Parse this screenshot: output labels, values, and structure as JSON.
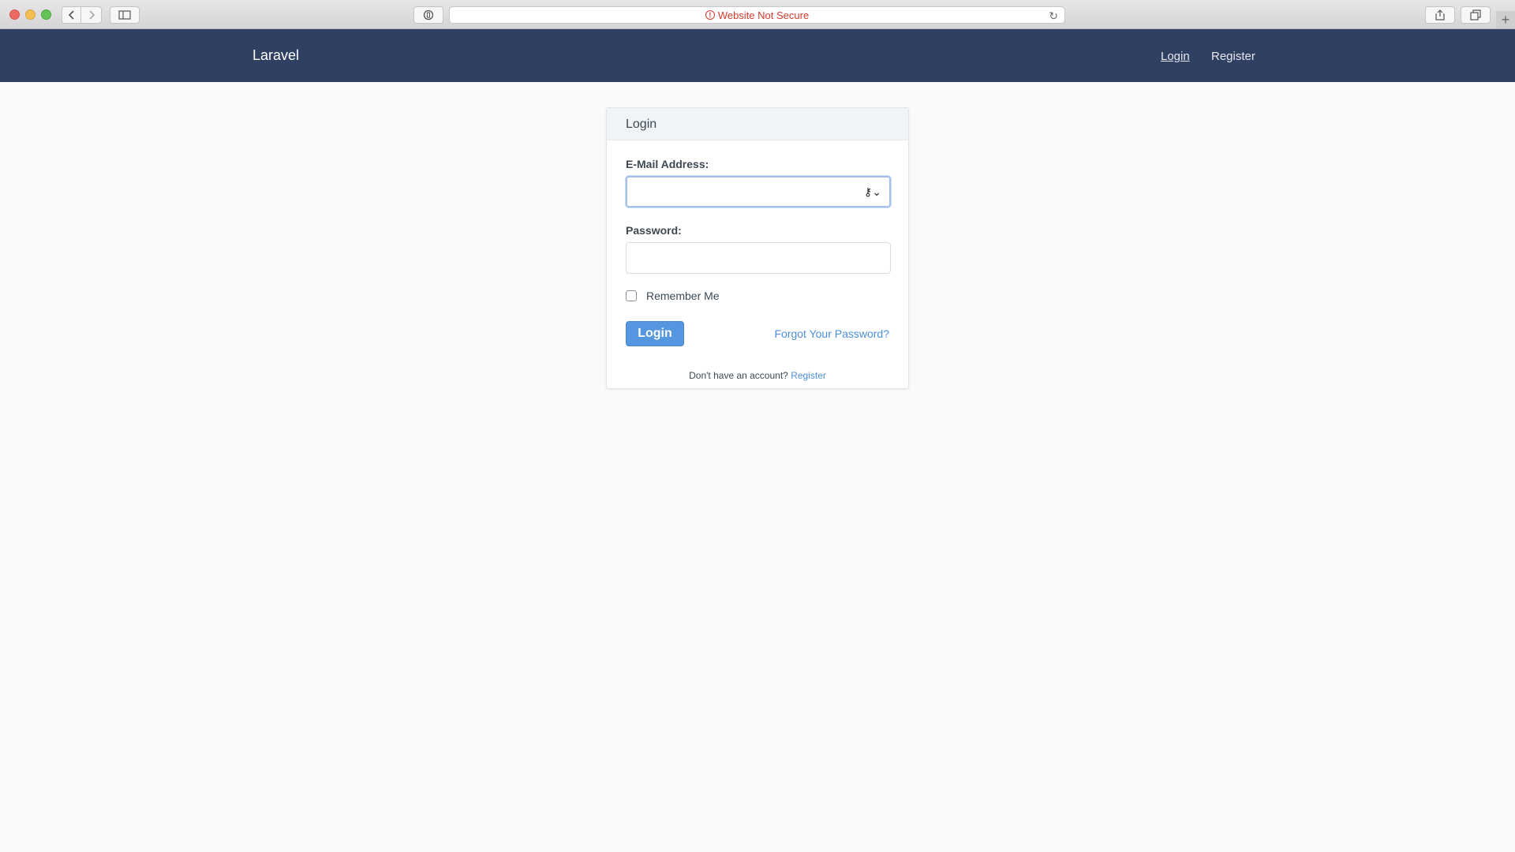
{
  "browser": {
    "address_text": "Website Not Secure",
    "warning_glyph": "!",
    "icons": [
      "back-icon",
      "forward-icon",
      "sidebar-icon",
      "privacy-icon",
      "reload-icon",
      "share-icon",
      "tabs-icon",
      "new-tab-icon"
    ],
    "warning_color": "#d33a2c"
  },
  "navbar": {
    "brand": "Laravel",
    "login_link": "Login",
    "register_link": "Register",
    "background": "#2f4062"
  },
  "card": {
    "title": "Login",
    "email_label": "E-Mail Address:",
    "email_value": "",
    "password_label": "Password:",
    "password_value": "",
    "remember_label": "Remember Me",
    "remember_checked": false,
    "login_button": "Login",
    "forgot_link": "Forgot Your Password?",
    "footer_text": "Don't have an account?",
    "footer_link": "Register",
    "accent_color": "#5596e0"
  }
}
